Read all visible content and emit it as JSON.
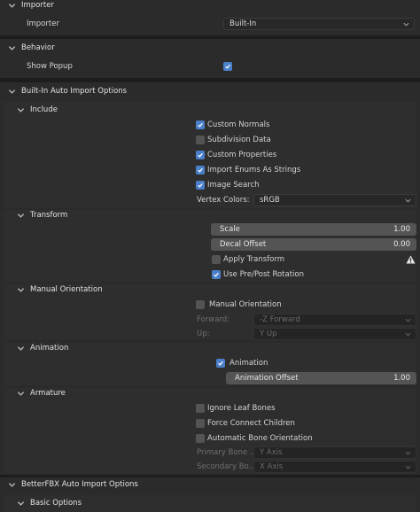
{
  "importer": {
    "header": "Importer",
    "importer_label": "Importer",
    "importer_value": "Built-In"
  },
  "behavior": {
    "header": "Behavior",
    "show_popup_label": "Show Popup",
    "show_popup_checked": true
  },
  "builtin": {
    "header": "Built-In Auto Import Options",
    "include": {
      "header": "Include",
      "custom_normals": {
        "label": "Custom Normals",
        "checked": true
      },
      "subdivision_data": {
        "label": "Subdivision Data",
        "checked": false
      },
      "custom_properties": {
        "label": "Custom Properties",
        "checked": true
      },
      "import_enums": {
        "label": "Import Enums As Strings",
        "checked": true
      },
      "image_search": {
        "label": "Image Search",
        "checked": true
      },
      "vertex_colors_label": "Vertex Colors:",
      "vertex_colors_value": "sRGB"
    },
    "transform": {
      "header": "Transform",
      "scale_label": "Scale",
      "scale_value": "1.00",
      "decal_offset_label": "Decal Offset",
      "decal_offset_value": "0.00",
      "apply_transform": {
        "label": "Apply Transform",
        "checked": false
      },
      "use_prepost": {
        "label": "Use Pre/Post Rotation",
        "checked": true
      }
    },
    "manual_orientation": {
      "header": "Manual Orientation",
      "manual_orientation": {
        "label": "Manual Orientation",
        "checked": false
      },
      "forward_label": "Forward:",
      "forward_value": "-Z Forward",
      "up_label": "Up:",
      "up_value": "Y Up"
    },
    "animation": {
      "header": "Animation",
      "animation": {
        "label": "Animation",
        "checked": true
      },
      "offset_label": "Animation Offset",
      "offset_value": "1.00"
    },
    "armature": {
      "header": "Armature",
      "ignore_leaf": {
        "label": "Ignore Leaf Bones",
        "checked": false
      },
      "force_connect": {
        "label": "Force Connect Children",
        "checked": false
      },
      "auto_bone": {
        "label": "Automatic Bone Orientation",
        "checked": false
      },
      "primary_label": "Primary Bone ...",
      "primary_value": "Y Axis",
      "secondary_label": "Secondary Bo...",
      "secondary_value": "X Axis"
    }
  },
  "betterfbx": {
    "header": "BetterFBX Auto Import Options",
    "basic_header": "Basic Options"
  },
  "colors": {
    "accent": "#4a7fc9",
    "panel": "#2b2b2b",
    "background": "#1d1d1d"
  },
  "icons": {
    "collapse": "chevron-down-icon",
    "dropdown": "dropdown-arrow-icon",
    "check": "checkmark-icon",
    "warning": "warning-icon"
  }
}
